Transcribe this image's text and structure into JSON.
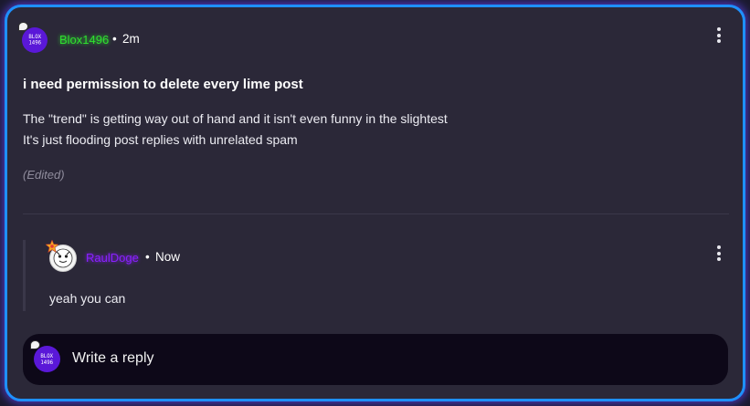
{
  "post": {
    "author": "Blox1496",
    "author_color": "#2fe02f",
    "avatar_text_line1": "BLOX",
    "avatar_text_line2": "1496",
    "separator": "•",
    "time": "2m",
    "title": "i need permission to delete every lime post",
    "body_lines": [
      "The \"trend\" is getting way out of hand and it isn't even funny in the slightest",
      "It's just flooding post replies with unrelated spam"
    ],
    "edited_label": "(Edited)"
  },
  "reply": {
    "author": "RaulDoge",
    "author_color": "#8a20ff",
    "separator": "•",
    "time": "Now",
    "text": "yeah you can"
  },
  "composer": {
    "avatar_text_line1": "BLOX",
    "avatar_text_line2": "1496",
    "placeholder": "Write a reply"
  },
  "colors": {
    "border": "#1e90ff",
    "glow": "#6446ff",
    "card_bg": "#2b2838",
    "composer_bg": "#0d0818"
  },
  "icons": {
    "menu": "kebab-menu-icon",
    "chat_badge": "chat-bubble-icon",
    "star_badge": "star-icon"
  }
}
